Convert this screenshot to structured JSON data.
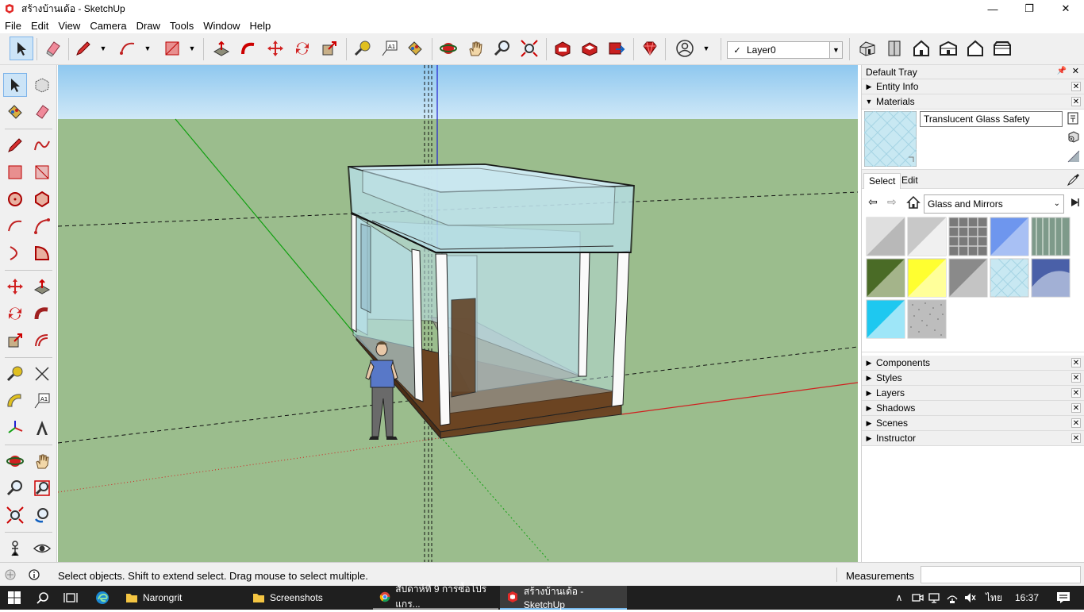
{
  "window": {
    "title": "สร้างบ้านเด้อ - SketchUp",
    "minimize": "—",
    "maximize": "❐",
    "close": "✕"
  },
  "menu": {
    "items": [
      "File",
      "Edit",
      "View",
      "Camera",
      "Draw",
      "Tools",
      "Window",
      "Help"
    ]
  },
  "toolbar": {
    "layer_name": "Layer0"
  },
  "tray": {
    "title": "Default Tray",
    "panels_top": [
      {
        "label": "Entity Info",
        "expanded": false
      },
      {
        "label": "Materials",
        "expanded": true
      }
    ],
    "materials": {
      "current_name": "Translucent Glass Safety",
      "tabs": [
        "Select",
        "Edit"
      ],
      "library": "Glass and Mirrors",
      "swatches": [
        {
          "name": "Mirror 1",
          "color": "#cfcfcf"
        },
        {
          "name": "Mirror 2",
          "color": "#e0e0e0"
        },
        {
          "name": "Block Glass",
          "color": "#8c8c8c"
        },
        {
          "name": "Translucent Blue",
          "color": "#6e96ee"
        },
        {
          "name": "Glass Corrugated",
          "color": "#86a092"
        },
        {
          "name": "Translucent Green",
          "color": "#4a6b26"
        },
        {
          "name": "Translucent Yellow",
          "color": "#ffff30"
        },
        {
          "name": "Translucent Gray",
          "color": "#909090"
        },
        {
          "name": "Translucent Glass Safety",
          "color": "#bfe4f2"
        },
        {
          "name": "Sky Reflection",
          "color": "#4a60a8"
        },
        {
          "name": "Translucent Cyan",
          "color": "#1ec8f0"
        },
        {
          "name": "Frosted Glass",
          "color": "#bdbdbd"
        }
      ]
    },
    "panels_bottom": [
      "Components",
      "Styles",
      "Layers",
      "Shadows",
      "Scenes",
      "Instructor"
    ]
  },
  "statusbar": {
    "hint": "Select objects. Shift to extend select. Drag mouse to select multiple.",
    "measurements_label": "Measurements",
    "measurements_value": ""
  },
  "taskbar": {
    "apps": [
      {
        "label": "Narongrit",
        "state": "normal"
      },
      {
        "label": "Screenshots",
        "state": "normal"
      },
      {
        "label": "สัปดาห์ที่ 9 การซื้อโปรแกร...",
        "state": "open"
      },
      {
        "label": "สร้างบ้านเด้อ - SketchUp",
        "state": "active"
      }
    ],
    "language": "ไทย",
    "time": "16:37"
  },
  "colors": {
    "sky": "#a8d4f2",
    "ground": "#9bbd8d",
    "accent": "#cce4f7",
    "axis_red": "#d02020",
    "axis_green": "#10b010",
    "axis_blue": "#2020d0",
    "floor_wood": "#6b4422",
    "glass": "#b9e2ee"
  }
}
